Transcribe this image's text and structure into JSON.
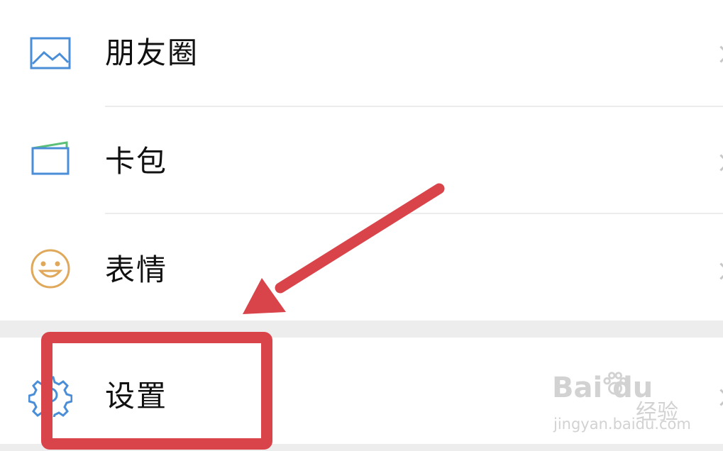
{
  "menu": {
    "items": [
      {
        "label": "朋友圈",
        "icon": "image-icon",
        "icon_color": "#4a8ed8"
      },
      {
        "label": "卡包",
        "icon": "wallet-icon",
        "icon_color": "#4a8ed8"
      },
      {
        "label": "表情",
        "icon": "smiley-icon",
        "icon_color": "#e0a85a"
      },
      {
        "label": "设置",
        "icon": "gear-icon",
        "icon_color": "#4a8ed8"
      }
    ]
  },
  "annotation": {
    "color": "#d9434a",
    "arrow_icon": "arrow-icon",
    "highlight": "highlight-box"
  },
  "watermark": {
    "brand": "Bai du",
    "service": "经验",
    "url": "jingyan.baidu.com"
  }
}
